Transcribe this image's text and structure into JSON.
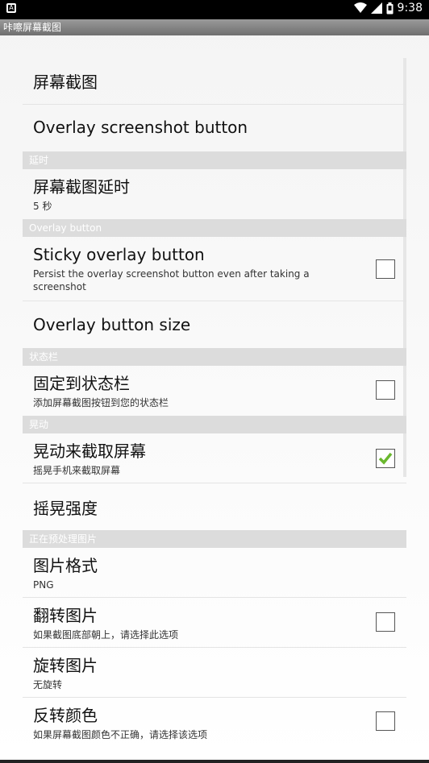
{
  "status_bar": {
    "time": "9:38",
    "icons": [
      "wifi-icon",
      "signal-icon",
      "battery-icon"
    ],
    "left_icon": "A"
  },
  "app": {
    "title": "咔嚓屏幕截图"
  },
  "sections": {
    "screenshot": {
      "items": [
        {
          "title": "屏幕截图"
        },
        {
          "title": "Overlay screenshot button"
        }
      ]
    },
    "delay": {
      "header": "延时",
      "items": [
        {
          "title": "屏幕截图延时",
          "summary": "5 秒"
        }
      ]
    },
    "overlay": {
      "header": "Overlay button",
      "items": [
        {
          "title": "Sticky overlay button",
          "summary": "Persist the overlay screenshot button even after taking a screenshot",
          "checked": false
        },
        {
          "title": "Overlay button size"
        }
      ]
    },
    "statusbar": {
      "header": "状态栏",
      "items": [
        {
          "title": "固定到状态栏",
          "summary": "添加屏幕截图按钮到您的状态栏",
          "checked": false
        }
      ]
    },
    "shake": {
      "header": "晃动",
      "items": [
        {
          "title": "晃动来截取屏幕",
          "summary": "摇晃手机来截取屏幕",
          "checked": true
        },
        {
          "title": "摇晃强度"
        }
      ]
    },
    "processing": {
      "header": "正在预处理图片",
      "items": [
        {
          "title": "图片格式",
          "summary": "PNG"
        },
        {
          "title": "翻转图片",
          "summary": "如果截图底部朝上，请选择此选项",
          "checked": false
        },
        {
          "title": "旋转图片",
          "summary": "无旋转"
        },
        {
          "title": "反转颜色",
          "summary": "如果屏幕截图颜色不正确，请选择该选项",
          "checked": false
        }
      ]
    }
  },
  "colors": {
    "check_mark": "#6ab82e",
    "header_bg": "#dcdcdc",
    "title_bar": "#7a7a7a"
  }
}
